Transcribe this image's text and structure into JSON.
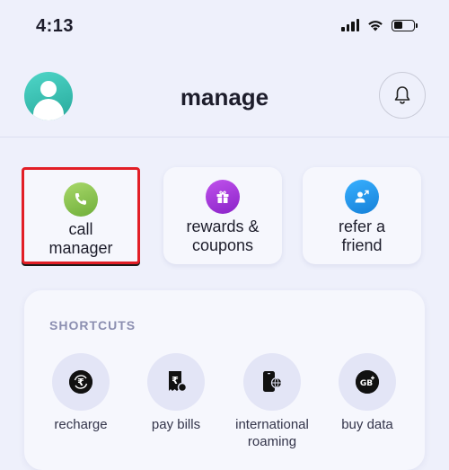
{
  "status_bar": {
    "time": "4:13"
  },
  "header": {
    "title": "manage"
  },
  "cards": [
    {
      "label_line1": "call",
      "label_line2": "manager",
      "icon": "phone-icon",
      "color": "#8bc34a"
    },
    {
      "label_line1": "rewards &",
      "label_line2": "coupons",
      "icon": "gift-icon",
      "color": "#a634d8"
    },
    {
      "label_line1": "refer a",
      "label_line2": "friend",
      "icon": "refer-user-icon",
      "color": "#1e96e8"
    }
  ],
  "shortcuts": {
    "title": "SHORTCUTS",
    "items": [
      {
        "label_line1": "recharge",
        "label_line2": "",
        "icon": "rupee-refresh-icon"
      },
      {
        "label_line1": "pay bills",
        "label_line2": "",
        "icon": "bill-receipt-icon"
      },
      {
        "label_line1": "international",
        "label_line2": "roaming",
        "icon": "phone-globe-icon"
      },
      {
        "label_line1": "buy data",
        "label_line2": "",
        "icon": "gb-plus-icon"
      }
    ]
  },
  "colors": {
    "background": "#eef0fb",
    "highlight": "#e21e26",
    "card": "#f6f7fd"
  }
}
